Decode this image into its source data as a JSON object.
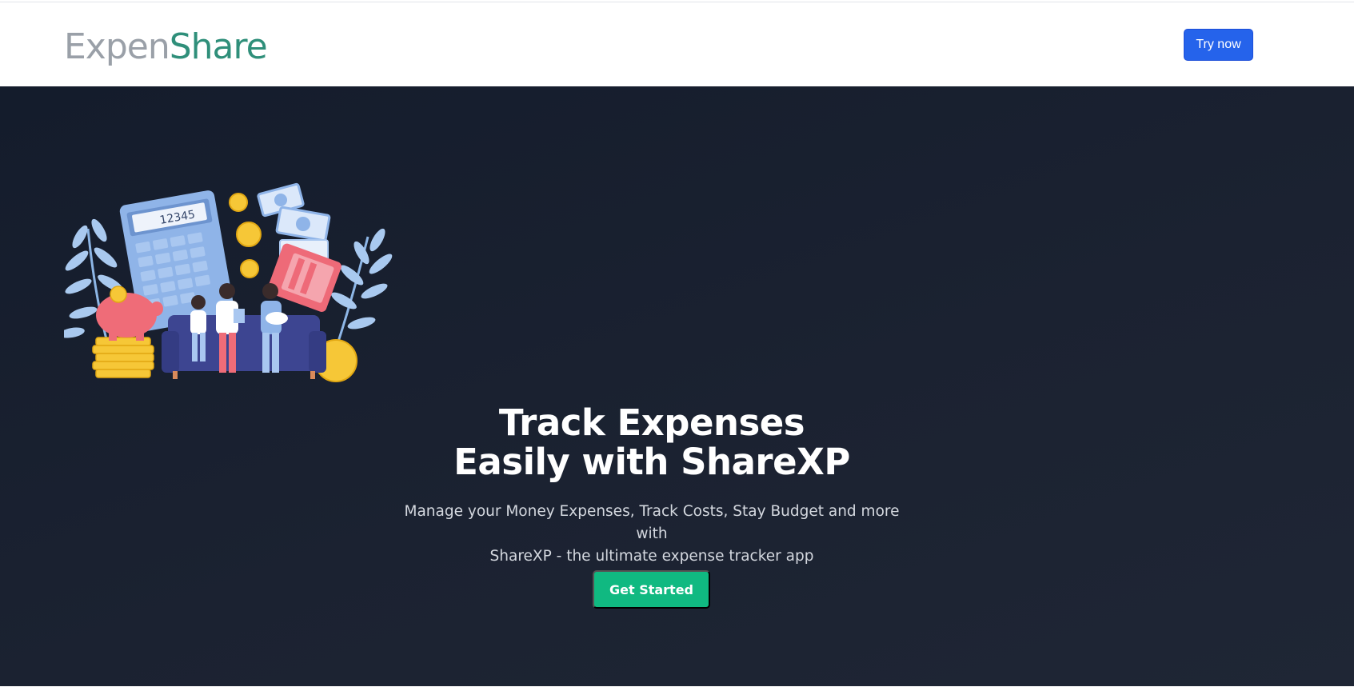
{
  "header": {
    "logo_part1": "Ex",
    "logo_part2": "pen",
    "logo_part3": "Share",
    "try_button": "Try now"
  },
  "hero": {
    "title_line1": "Track Expenses",
    "title_line2": "Easily with ShareXP",
    "subtitle_line1": "Manage your Money Expenses, Track Costs, Stay Budget and more with",
    "subtitle_line2": "ShareXP - the ultimate expense tracker app",
    "cta_label": "Get Started",
    "calculator_display": "12345"
  },
  "colors": {
    "nav_button": "#2563eb",
    "cta_button": "#10b981",
    "hero_background": "#1b2231",
    "logo_gray": "#9aa0a8",
    "logo_green": "#2f8f7a"
  }
}
